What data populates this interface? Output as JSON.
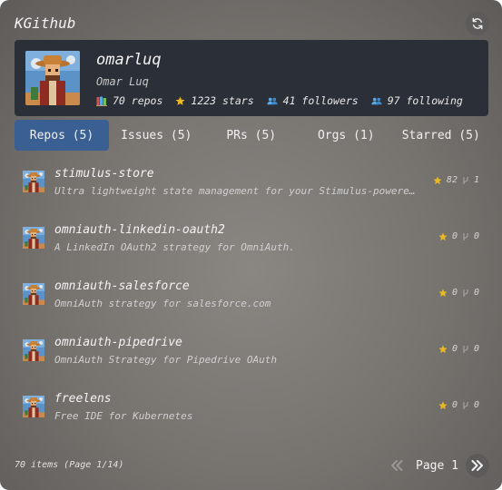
{
  "app": {
    "title": "KGithub"
  },
  "profile": {
    "username": "omarluq",
    "full_name": "Omar Luq",
    "repos": "70 repos",
    "stars": "1223 stars",
    "followers": "41 followers",
    "following": "97 following"
  },
  "tabs": [
    {
      "label": "Repos (5)",
      "active": true
    },
    {
      "label": "Issues (5)",
      "active": false
    },
    {
      "label": "PRs (5)",
      "active": false
    },
    {
      "label": "Orgs (1)",
      "active": false
    },
    {
      "label": "Starred (5)",
      "active": false
    }
  ],
  "repos": [
    {
      "name": "stimulus-store",
      "description": "Ultra lightweight state management for your Stimulus-powered apps",
      "stars": "82",
      "forks": "1"
    },
    {
      "name": "omniauth-linkedin-oauth2",
      "description": "A LinkedIn OAuth2 strategy for OmniAuth.",
      "stars": "0",
      "forks": "0"
    },
    {
      "name": "omniauth-salesforce",
      "description": "OmniAuth strategy for salesforce.com",
      "stars": "0",
      "forks": "0"
    },
    {
      "name": "omniauth-pipedrive",
      "description": "OmniAuth Strategy for Pipedrive OAuth",
      "stars": "0",
      "forks": "0"
    },
    {
      "name": "freelens",
      "description": "Free IDE for Kubernetes",
      "stars": "0",
      "forks": "0"
    }
  ],
  "footer": {
    "items_info": "70 items (Page 1/14)",
    "page_label": "Page 1"
  },
  "icons": {
    "refresh": "refresh-icon",
    "repos": "books-icon",
    "stars": "star-icon",
    "followers": "people-icon",
    "following": "people-icon",
    "fork": "fork-icon",
    "prev": "double-chevron-left-icon",
    "next": "double-chevron-right-icon"
  },
  "colors": {
    "profile_bg": "#2b2f37",
    "active_tab": "#3a5f93",
    "star": "#e8b923",
    "people": "#5aa9e6"
  }
}
